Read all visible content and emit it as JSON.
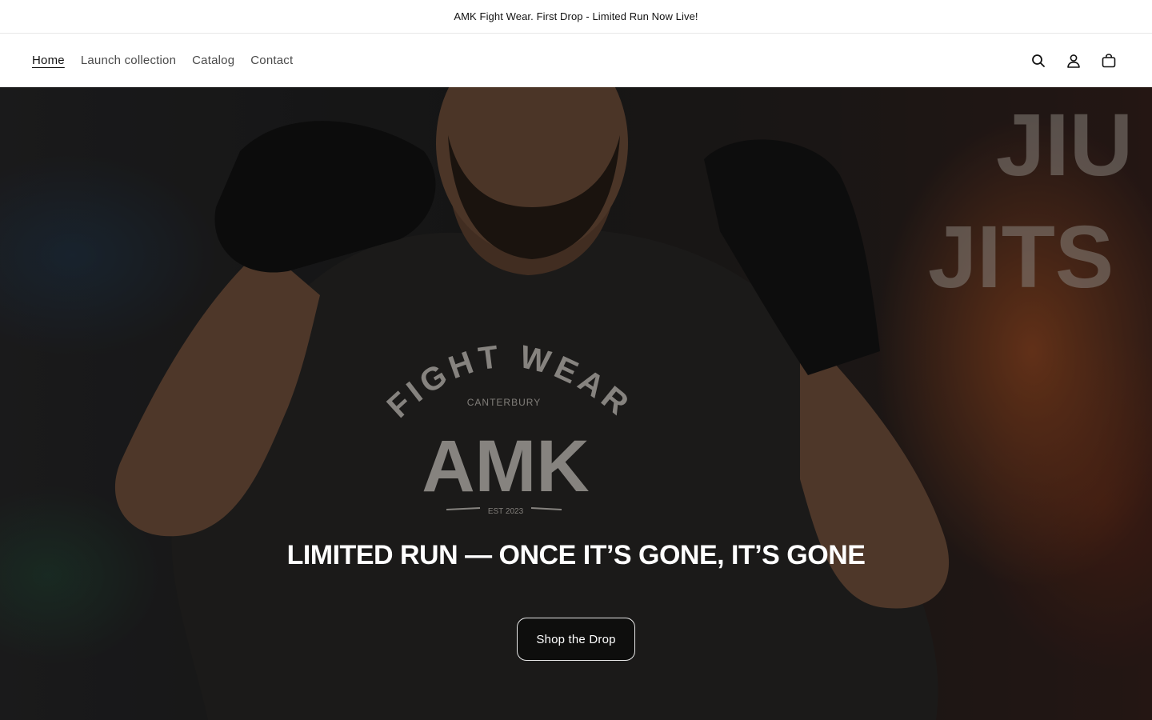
{
  "announcement": {
    "text": "AMK Fight Wear. First Drop - Limited Run Now Live!"
  },
  "nav": {
    "items": [
      {
        "label": "Home",
        "active": true
      },
      {
        "label": "Launch collection",
        "active": false
      },
      {
        "label": "Catalog",
        "active": false
      },
      {
        "label": "Contact",
        "active": false
      }
    ]
  },
  "header_icons": [
    "search-icon",
    "account-icon",
    "cart-icon"
  ],
  "hero": {
    "shirt_text": {
      "arc": "FIGHT WEAR",
      "sub": "CANTERBURY",
      "brand": "AMK",
      "est": "EST 2023"
    },
    "wall_text": [
      "JIU",
      "JITS"
    ],
    "title": "LIMITED RUN — ONCE IT’S GONE, IT’S GONE",
    "cta_label": "Shop the Drop"
  },
  "colors": {
    "accent": "#121212",
    "background": "#ffffff",
    "hero_overlay": "#000000"
  }
}
